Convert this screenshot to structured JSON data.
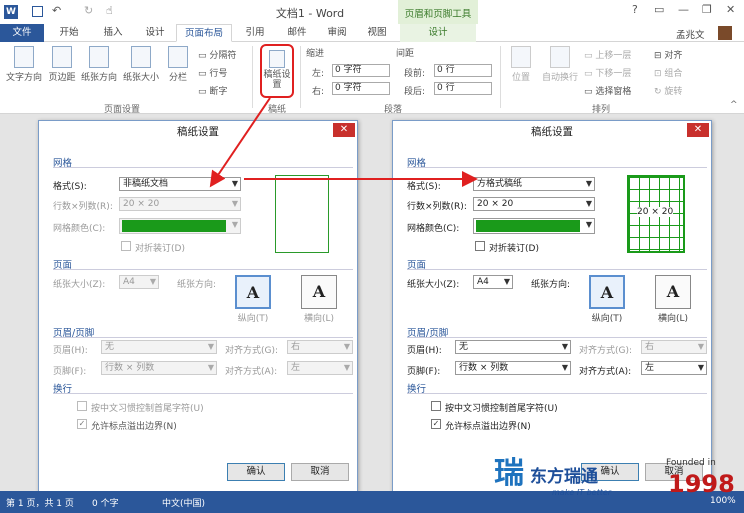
{
  "titlebar": {
    "title": "文档1 - Word",
    "context_tool": "页眉和页脚工具"
  },
  "tabs": [
    {
      "label": "文件"
    },
    {
      "label": "开始"
    },
    {
      "label": "插入"
    },
    {
      "label": "设计"
    },
    {
      "label": "页面布局"
    },
    {
      "label": "引用"
    },
    {
      "label": "邮件"
    },
    {
      "label": "审阅"
    },
    {
      "label": "视图"
    },
    {
      "label": "设计"
    }
  ],
  "user": {
    "name": "孟兆文"
  },
  "ribbon": {
    "page_setup": {
      "group": "页面设置",
      "text_direction": "文字方向",
      "margins": "页边距",
      "orientation": "纸张方向",
      "size": "纸张大小",
      "columns": "分栏",
      "breaks": "分隔符",
      "line_numbers": "行号",
      "hyphenation": "断字"
    },
    "draft": {
      "group": "稿纸",
      "button": "稿纸设置"
    },
    "paragraph": {
      "group": "段落",
      "indent": "缩进",
      "spacing": "间距",
      "left": "左:",
      "right": "右:",
      "before": "段前:",
      "after": "段后:",
      "left_val": "0 字符",
      "right_val": "0 字符",
      "before_val": "0 行",
      "after_val": "0 行"
    },
    "arrange": {
      "group": "排列",
      "position": "位置",
      "wrap": "自动换行",
      "forward": "上移一层",
      "backward": "下移一层",
      "pane": "选择窗格",
      "align": "对齐",
      "group_btn": "组合",
      "rotate": "旋转"
    }
  },
  "dialog_left": {
    "title": "稿纸设置",
    "sec_grid": "网格",
    "format_label": "格式(S):",
    "format_value": "非稿纸文档",
    "rowcol_label": "行数×列数(R):",
    "rowcol_value": "20 × 20",
    "color_label": "网格颜色(C):",
    "fold_label": "对折装订(D)",
    "sec_page": "页面",
    "size_label": "纸张大小(Z):",
    "size_value": "A4",
    "orient_label": "纸张方向:",
    "portrait": "纵向(T)",
    "landscape": "横向(L)",
    "sec_hf": "页眉/页脚",
    "header_label": "页眉(H):",
    "header_value": "无",
    "footer_label": "页脚(F):",
    "footer_value": "行数 × 列数",
    "align_label": "对齐方式(G):",
    "align_header": "右",
    "align2_label": "对齐方式(A):",
    "align_footer": "左",
    "sec_wrap": "换行",
    "opt1": "按中文习惯控制首尾字符(U)",
    "opt2": "允许标点溢出边界(N)",
    "ok": "确认",
    "cancel": "取消"
  },
  "dialog_right": {
    "title": "稿纸设置",
    "sec_grid": "网格",
    "format_label": "格式(S):",
    "format_value": "方格式稿纸",
    "rowcol_label": "行数×列数(R):",
    "rowcol_value": "20 × 20",
    "color_label": "网格颜色(C):",
    "fold_label": "对折装订(D)",
    "preview_label": "20 × 20",
    "sec_page": "页面",
    "size_label": "纸张大小(Z):",
    "size_value": "A4",
    "orient_label": "纸张方向:",
    "portrait": "纵向(T)",
    "landscape": "横向(L)",
    "sec_hf": "页眉/页脚",
    "header_label": "页眉(H):",
    "header_value": "无",
    "footer_label": "页脚(F):",
    "footer_value": "行数 × 列数",
    "align_label": "对齐方式(G):",
    "align_header": "右",
    "align2_label": "对齐方式(A):",
    "align_footer": "左",
    "sec_wrap": "换行",
    "opt1": "按中文习惯控制首尾字符(U)",
    "opt2": "允许标点溢出边界(N)",
    "ok": "确认",
    "cancel": "取消"
  },
  "status": {
    "page": "第 1 页，共 1 页",
    "words": "0 个字",
    "lang": "中文(中国)",
    "zoom": "100%"
  },
  "watermark": {
    "brand": "东方瑞通",
    "slogan": "make IT better",
    "founded": "Founded in",
    "year": "1998"
  },
  "colors": {
    "word_blue": "#2b579a",
    "grid_green": "#1a9a1a",
    "highlight_red": "#e02020"
  }
}
